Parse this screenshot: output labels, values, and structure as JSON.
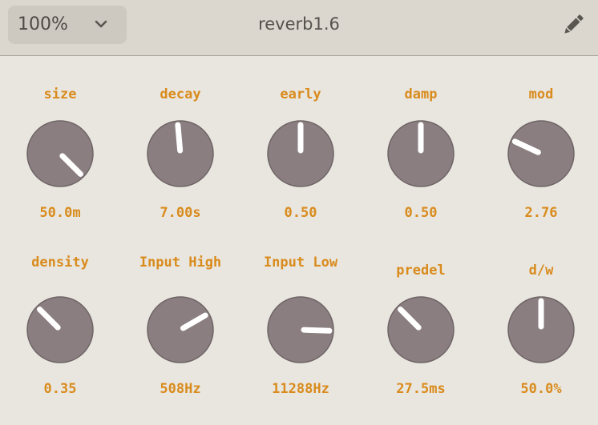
{
  "header": {
    "zoom_value": "100%",
    "title": "reverb1.6"
  },
  "icons": {
    "zoom_dropdown": "chevron-down-icon",
    "edit": "pencil-icon"
  },
  "colors": {
    "accent_label": "#d98b1d",
    "knob_body": "#8a7e80",
    "knob_pointer": "#ffffff",
    "background": "#e9e6df",
    "topbar": "#dbd7cf"
  },
  "knobs": [
    {
      "id": "size",
      "label": "size",
      "value": "50.0m",
      "pointer_angle_deg": 135
    },
    {
      "id": "decay",
      "label": "decay",
      "value": "7.00s",
      "pointer_angle_deg": -5
    },
    {
      "id": "early",
      "label": "early",
      "value": "0.50",
      "pointer_angle_deg": 0
    },
    {
      "id": "damp",
      "label": "damp",
      "value": "0.50",
      "pointer_angle_deg": 0
    },
    {
      "id": "mod",
      "label": "mod",
      "value": "2.76",
      "pointer_angle_deg": -65
    },
    {
      "id": "density",
      "label": "density",
      "value": "0.35",
      "pointer_angle_deg": -45
    },
    {
      "id": "input_high",
      "label": "Input High",
      "value": "508Hz",
      "pointer_angle_deg": 60
    },
    {
      "id": "input_low",
      "label": "Input Low",
      "value": "11288Hz",
      "pointer_angle_deg": 92
    },
    {
      "id": "predel",
      "label": "predel",
      "value": "27.5ms",
      "pointer_angle_deg": -45
    },
    {
      "id": "dw",
      "label": "d/w",
      "value": "50.0%",
      "pointer_angle_deg": 0
    }
  ]
}
